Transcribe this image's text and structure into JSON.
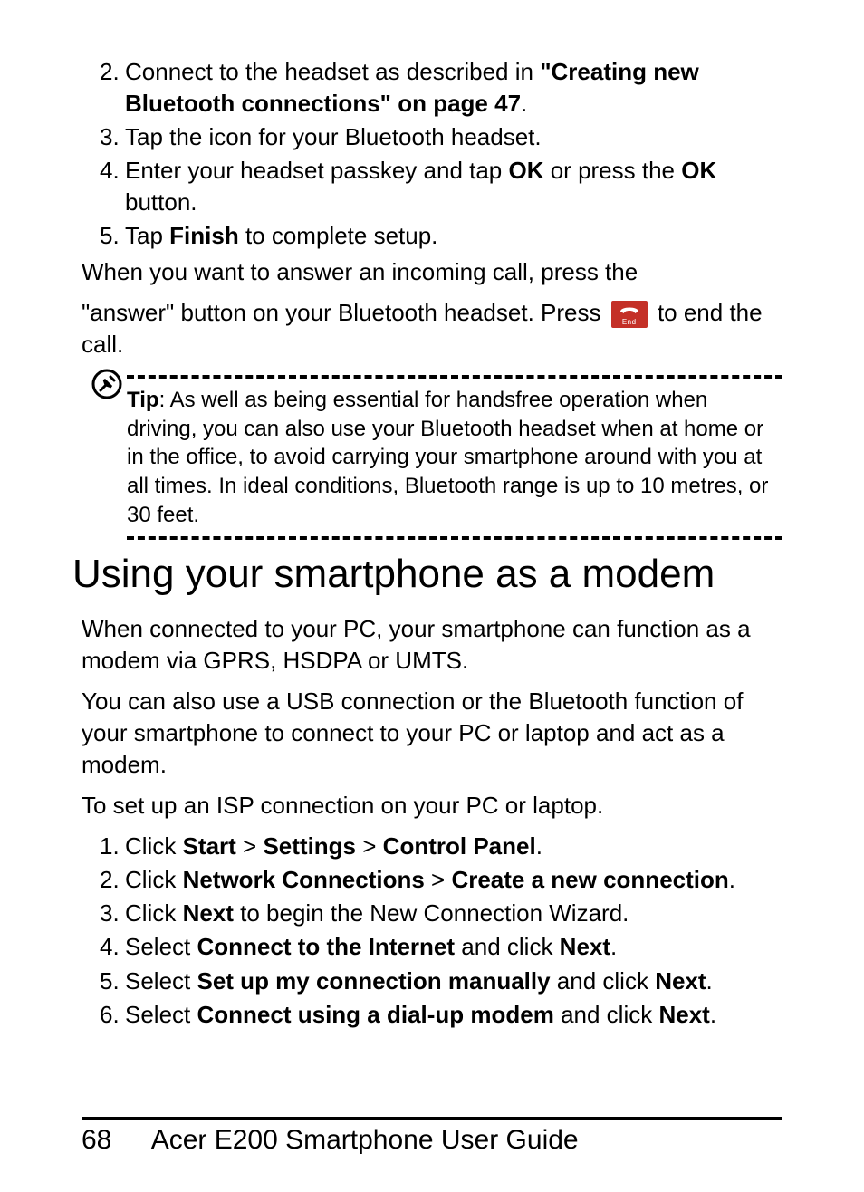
{
  "list_top": [
    {
      "n": "2.",
      "pre": "Connect to the headset as described in ",
      "bold": "\"Creating new Bluetooth connections\" on page 47",
      "post": "."
    },
    {
      "n": "3.",
      "plain": "Tap the icon for your Bluetooth headset."
    },
    {
      "n": "4.",
      "segments": [
        "Enter your headset passkey and tap ",
        {
          "b": "OK"
        },
        " or press the ",
        {
          "b": "OK"
        },
        " button."
      ]
    },
    {
      "n": "5.",
      "segments": [
        "Tap ",
        {
          "b": "Finish"
        },
        " to complete setup."
      ]
    }
  ],
  "para_after_list": "When you want to answer an incoming call, press the",
  "para_answer_pre": "\"answer\" button on your Bluetooth headset. Press ",
  "para_answer_post": " to end the call.",
  "end_icon_label": "End",
  "tip_label": "Tip",
  "tip_body": ": As well as being essential for handsfree operation when driving, you can also use your Bluetooth headset when at home or in the office, to avoid carrying your smartphone around with you at all times. In ideal conditions, Bluetooth range is up to 10 metres, or 30 feet.",
  "section_heading": "Using your smartphone as a modem",
  "modem_p1": "When connected to your PC, your smartphone can function as a modem via GPRS, HSDPA or UMTS.",
  "modem_p2": "You can also use a USB connection or the Bluetooth function of your smartphone to connect to your PC or laptop and act as a modem.",
  "modem_p3": "To set up an ISP connection on your PC or laptop.",
  "list_bottom": [
    {
      "n": "1.",
      "segments": [
        "Click ",
        {
          "b": "Start"
        },
        " > ",
        {
          "b": "Settings"
        },
        " > ",
        {
          "b": "Control Panel"
        },
        "."
      ]
    },
    {
      "n": "2.",
      "segments": [
        "Click ",
        {
          "b": "Network Connections"
        },
        " > ",
        {
          "b": "Create a new connection"
        },
        "."
      ]
    },
    {
      "n": "3.",
      "segments": [
        "Click ",
        {
          "b": "Next"
        },
        " to begin the New Connection Wizard."
      ]
    },
    {
      "n": "4.",
      "segments": [
        "Select ",
        {
          "b": "Connect to the Internet"
        },
        " and click ",
        {
          "b": "Next"
        },
        "."
      ]
    },
    {
      "n": "5.",
      "segments": [
        "Select ",
        {
          "b": "Set up my connection manually"
        },
        " and click ",
        {
          "b": "Next"
        },
        "."
      ]
    },
    {
      "n": "6.",
      "segments": [
        "Select ",
        {
          "b": "Connect using a dial-up modem"
        },
        " and click ",
        {
          "b": "Next"
        },
        "."
      ]
    }
  ],
  "footer": {
    "page": "68",
    "title": "Acer E200 Smartphone User Guide"
  }
}
